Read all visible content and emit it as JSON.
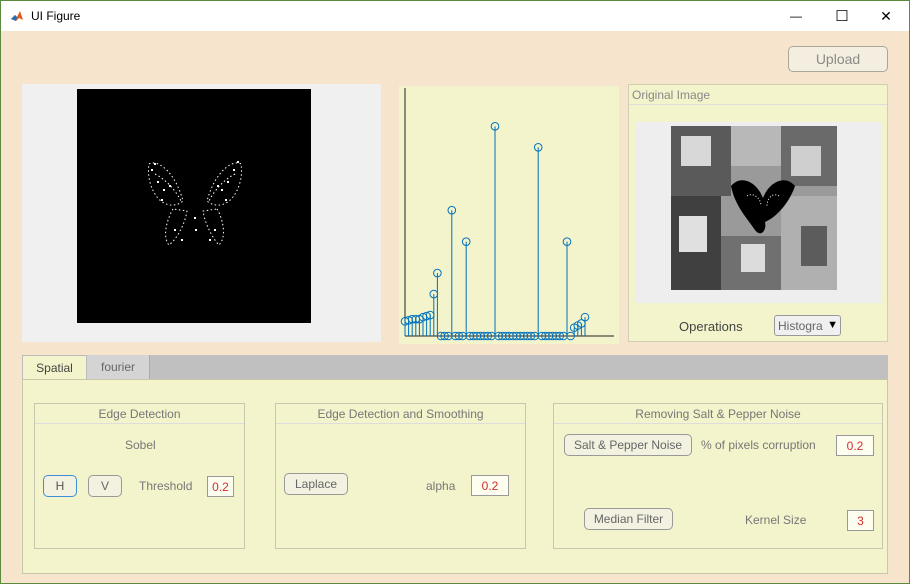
{
  "window": {
    "title": "UI Figure",
    "minimize_glyph": "—",
    "maximize_glyph": "☐",
    "close_glyph": "✕"
  },
  "toolbar": {
    "upload_label": "Upload"
  },
  "original_image_panel": {
    "title": "Original Image",
    "operations_label": "Operations",
    "operations_value": "Histogra"
  },
  "tabs": [
    {
      "label": "Spatial",
      "active": true
    },
    {
      "label": "fourier",
      "active": false
    }
  ],
  "spatial": {
    "edge_detection": {
      "title": "Edge Detection",
      "method_label": "Sobel",
      "h_label": "H",
      "v_label": "V",
      "threshold_label": "Threshold",
      "threshold_value": "0.2"
    },
    "edge_smoothing": {
      "title": "Edge Detection and Smoothing",
      "laplace_label": "Laplace",
      "alpha_label": "alpha",
      "alpha_value": "0.2"
    },
    "salt_pepper": {
      "title": "Removing Salt & Pepper Noise",
      "noise_button_label": "Salt & Pepper Noise",
      "corruption_label": "% of pixels corruption",
      "corruption_value": "0.2",
      "median_button_label": "Median Filter",
      "kernel_label": "Kernel Size",
      "kernel_value": "3"
    }
  },
  "colors": {
    "accent": "#0072bd",
    "background": "#f6e4cc",
    "panel": "#f3f3cc",
    "value_text": "#d03030"
  },
  "chart_data": {
    "type": "stem",
    "x": [
      0,
      1,
      2,
      3,
      4,
      5,
      6,
      7,
      8,
      9,
      10,
      11,
      12,
      13,
      14,
      15,
      16,
      17,
      18,
      19,
      20,
      21,
      22,
      23,
      24,
      25,
      26,
      27,
      28,
      29,
      30,
      31,
      32,
      33,
      34,
      35,
      36,
      37,
      38,
      39,
      40,
      41,
      42,
      43,
      44,
      45,
      46,
      47,
      48,
      49,
      50
    ],
    "values": [
      7,
      7.5,
      8,
      8,
      8,
      9,
      9.5,
      10,
      20,
      30,
      0,
      0,
      0,
      60,
      0,
      0,
      0,
      45,
      0,
      0,
      0,
      0,
      0,
      0,
      0,
      100,
      0,
      0,
      0,
      0,
      0,
      0,
      0,
      0,
      0,
      0,
      0,
      90,
      0,
      0,
      0,
      0,
      0,
      0,
      0,
      45,
      0,
      4,
      5,
      6,
      9
    ],
    "xlim": [
      0,
      50
    ],
    "ylim": [
      0,
      110
    ],
    "grid": false,
    "title": "",
    "xlabel": "",
    "ylabel": ""
  }
}
